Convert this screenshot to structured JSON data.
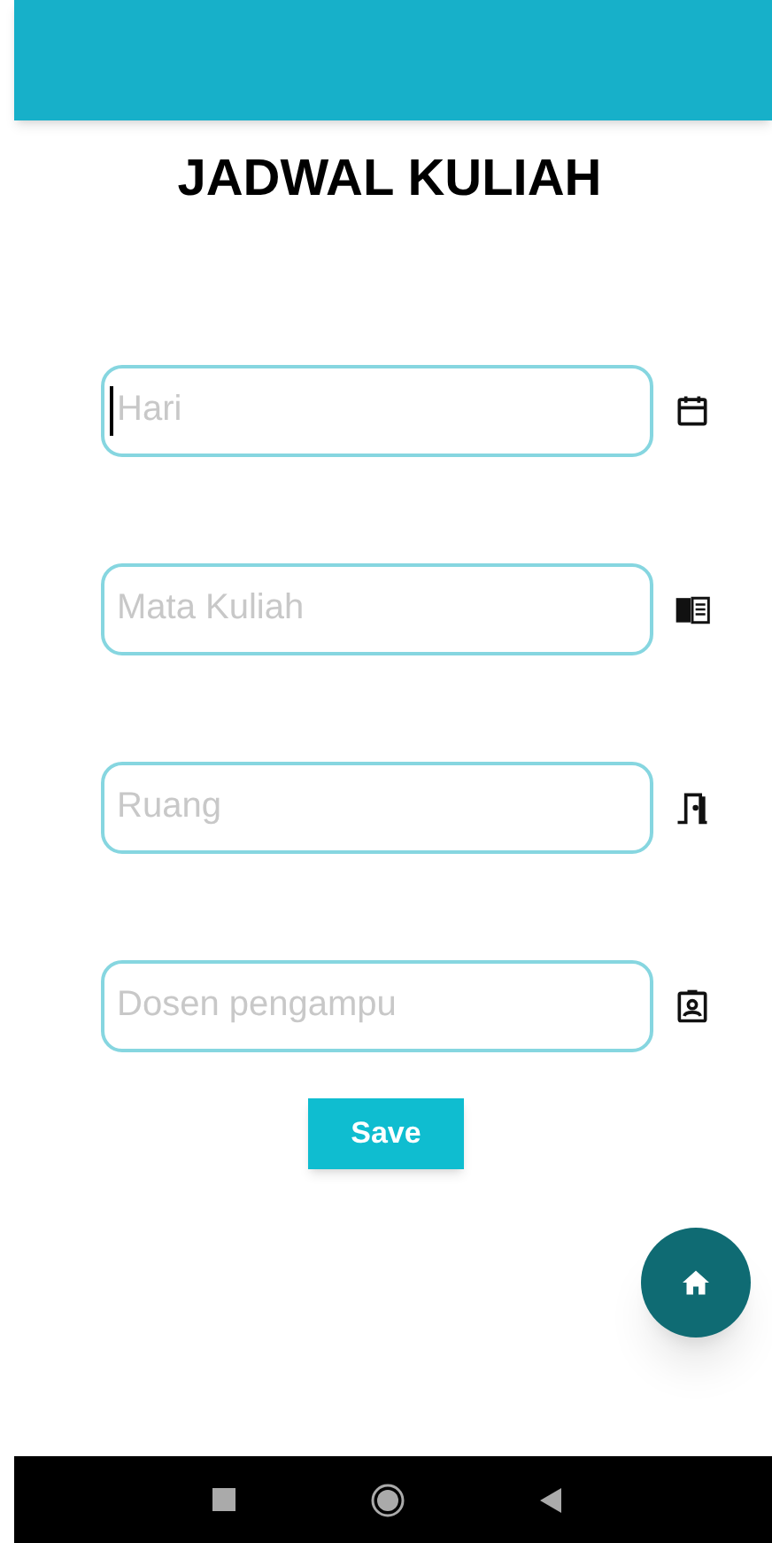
{
  "title": "JADWAL KULIAH",
  "fields": [
    {
      "placeholder": "Hari",
      "kind": "calendar",
      "focused": true
    },
    {
      "placeholder": "Mata Kuliah",
      "kind": "book",
      "focused": false
    },
    {
      "placeholder": "Ruang",
      "kind": "door",
      "focused": false
    },
    {
      "placeholder": "Dosen pengampu",
      "kind": "badge",
      "focused": false
    }
  ],
  "save_button": "Save"
}
